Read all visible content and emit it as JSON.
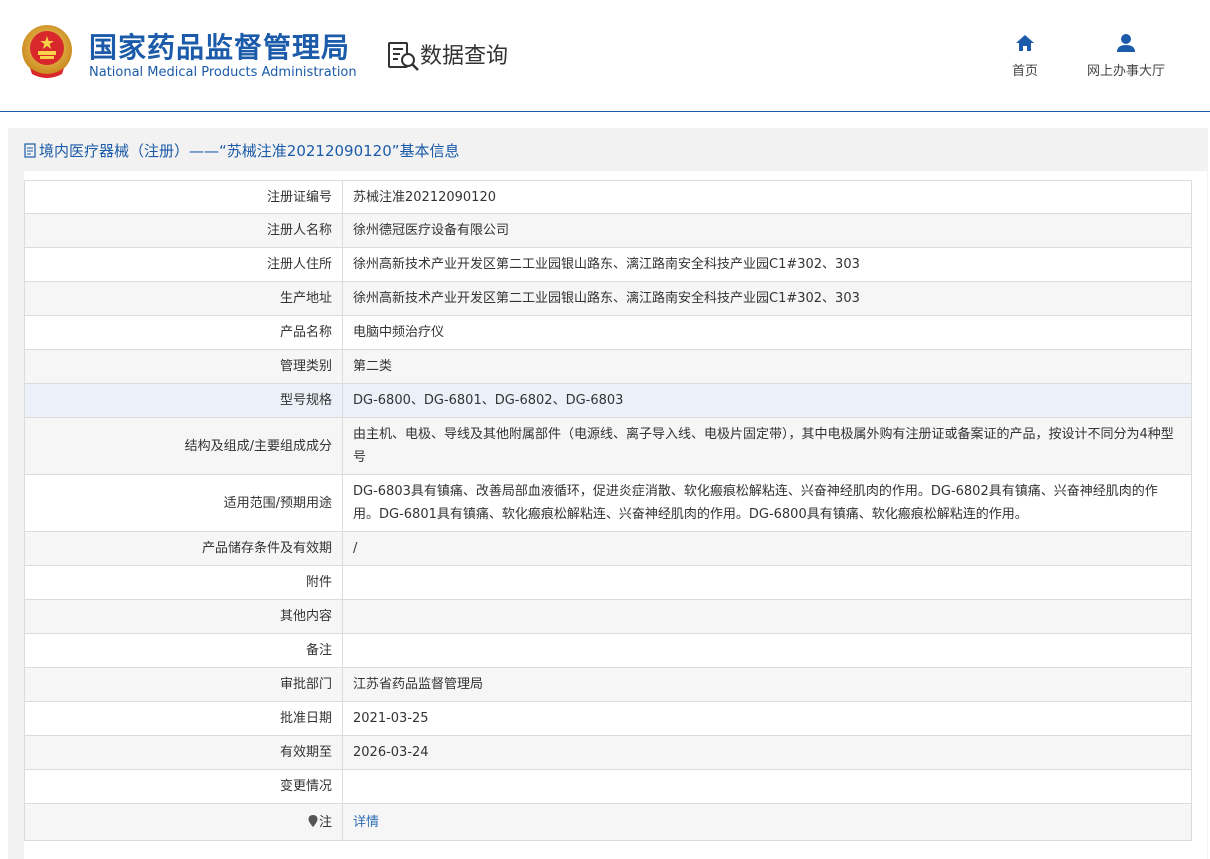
{
  "header": {
    "brand_cn": "国家药品监督管理局",
    "brand_en": "National Medical Products Administration",
    "query_title": "数据查询",
    "nav": [
      {
        "label": "首页",
        "icon": "home-icon"
      },
      {
        "label": "网上办事大厅",
        "icon": "user-icon"
      }
    ]
  },
  "panel": {
    "title": "境内医疗器械（注册）——“苏械注准20212090120”基本信息",
    "title_icon": "document-icon"
  },
  "rows": [
    {
      "label": "注册证编号",
      "value": "苏械注准20212090120"
    },
    {
      "label": "注册人名称",
      "value": "徐州德冠医疗设备有限公司"
    },
    {
      "label": "注册人住所",
      "value": "徐州高新技术产业开发区第二工业园银山路东、漓江路南安全科技产业园C1#302、303"
    },
    {
      "label": "生产地址",
      "value": "徐州高新技术产业开发区第二工业园银山路东、漓江路南安全科技产业园C1#302、303"
    },
    {
      "label": "产品名称",
      "value": "电脑中频治疗仪"
    },
    {
      "label": "管理类别",
      "value": "第二类"
    },
    {
      "label": "型号规格",
      "value": "DG-6800、DG-6801、DG-6802、DG-6803"
    },
    {
      "label": "结构及组成/主要组成成分",
      "value": "由主机、电极、导线及其他附属部件（电源线、离子导入线、电极片固定带），其中电极属外购有注册证或备案证的产品，按设计不同分为4种型号"
    },
    {
      "label": "适用范围/预期用途",
      "value": "DG-6803具有镇痛、改善局部血液循环，促进炎症消散、软化瘢痕松解粘连、兴奋神经肌肉的作用。DG-6802具有镇痛、兴奋神经肌肉的作用。DG-6801具有镇痛、软化瘢痕松解粘连、兴奋神经肌肉的作用。DG-6800具有镇痛、软化瘢痕松解粘连的作用。"
    },
    {
      "label": "产品储存条件及有效期",
      "value": "/"
    },
    {
      "label": "附件",
      "value": ""
    },
    {
      "label": "其他内容",
      "value": ""
    },
    {
      "label": "备注",
      "value": ""
    },
    {
      "label": "审批部门",
      "value": "江苏省药品监督管理局"
    },
    {
      "label": "批准日期",
      "value": "2021-03-25"
    },
    {
      "label": "有效期至",
      "value": "2026-03-24"
    },
    {
      "label": "变更情况",
      "value": ""
    }
  ],
  "note_row": {
    "label": "注",
    "icon": "pin-icon",
    "link": "详情"
  },
  "colors": {
    "brand": "#1b5ba9",
    "link": "#2d6db5",
    "highlight_row": "#ebf1f9",
    "panel_bg": "#f2f2f2"
  }
}
